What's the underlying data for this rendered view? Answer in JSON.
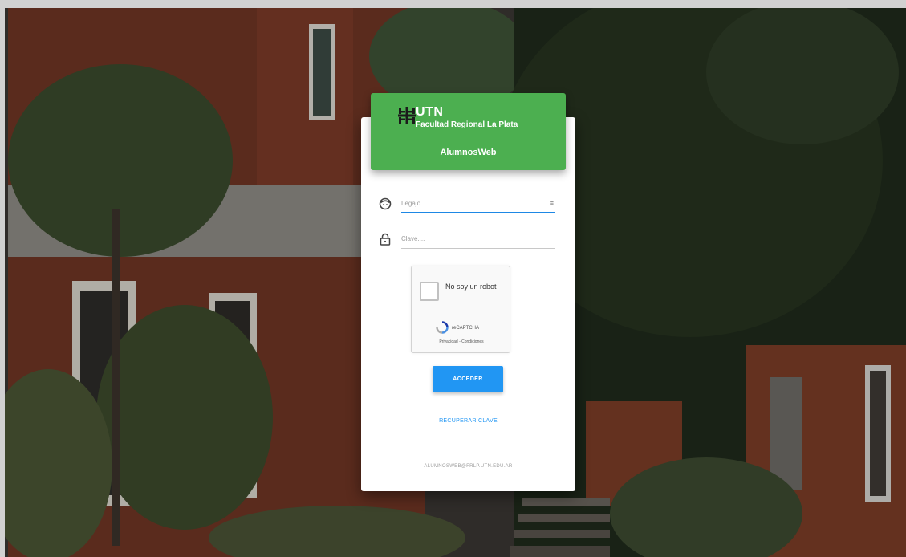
{
  "brand": {
    "name": "UTN",
    "subtitle": "Facultad Regional La Plata",
    "app_title": "AlumnosWeb",
    "header_color": "#4caf50",
    "logo_icon": "utn-logo-icon"
  },
  "form": {
    "user": {
      "placeholder": "Legajo...",
      "icon": "user-face-icon",
      "action_icon": "menu-grip-icon"
    },
    "password": {
      "placeholder": "Clave....",
      "icon": "lock-icon"
    }
  },
  "recaptcha": {
    "label": "No soy un robot",
    "brand": "reCAPTCHA",
    "terms": "Privacidad - Condiciones"
  },
  "actions": {
    "submit_label": "ACCEDER",
    "recover_label": "RECUPERAR CLAVE",
    "accent_color": "#2196f3"
  },
  "footer": {
    "email": "ALUMNOSWEB@FRLP.UTN.EDU.AR"
  }
}
